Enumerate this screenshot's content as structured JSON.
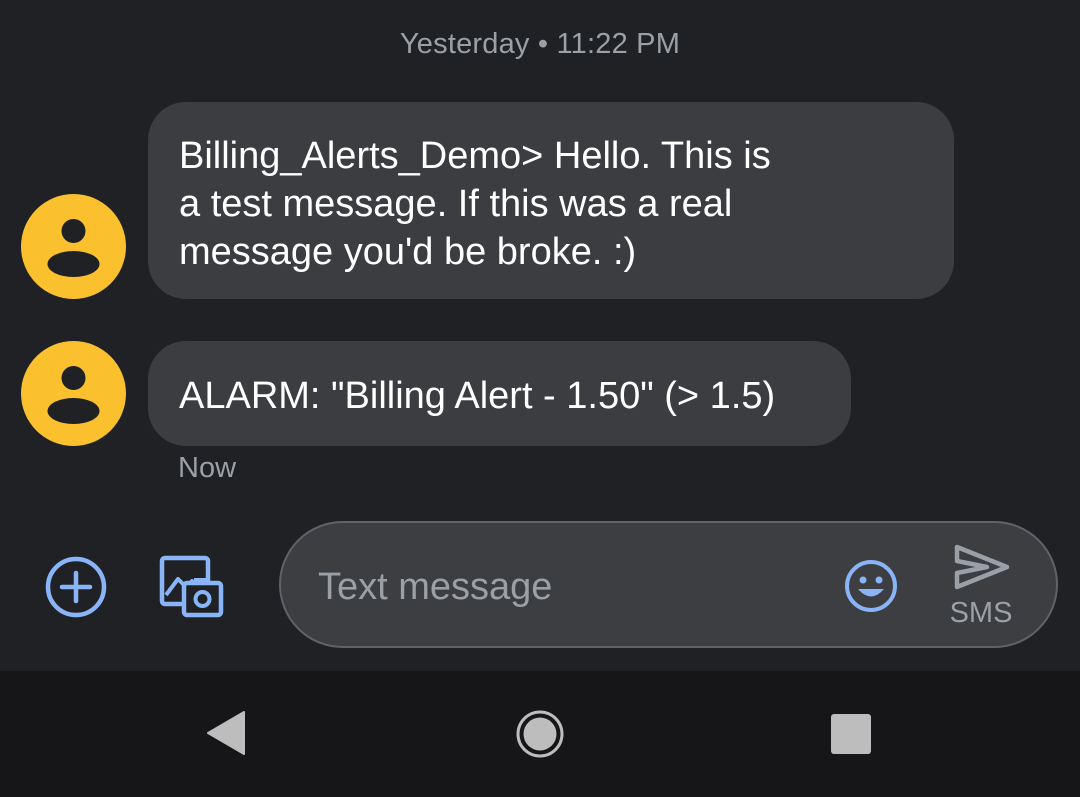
{
  "conversation": {
    "date_separator": "Yesterday • 11:22 PM",
    "messages": [
      {
        "lines": [
          "Billing_Alerts_Demo> Hello. This is",
          "a test message. If this was a real",
          "message you'd be broke. :)"
        ]
      },
      {
        "lines": [
          "ALARM: \"Billing Alert - 1.50\" (> 1.5)"
        ],
        "time": "Now"
      }
    ]
  },
  "compose": {
    "placeholder": "Text message",
    "send_label": "SMS"
  },
  "icons": {
    "avatar": "person-avatar-icon",
    "add": "add-circle-icon",
    "gallery": "gallery-camera-icon",
    "emoji": "emoji-icon",
    "send": "send-icon",
    "back": "back-triangle-icon",
    "home": "home-circle-icon",
    "recents": "recents-square-icon"
  },
  "colors": {
    "background": "#202124",
    "bubble": "#3c3d40",
    "avatar": "#fbc02d",
    "accent": "#8ab4f8",
    "navbar": "#161618"
  }
}
